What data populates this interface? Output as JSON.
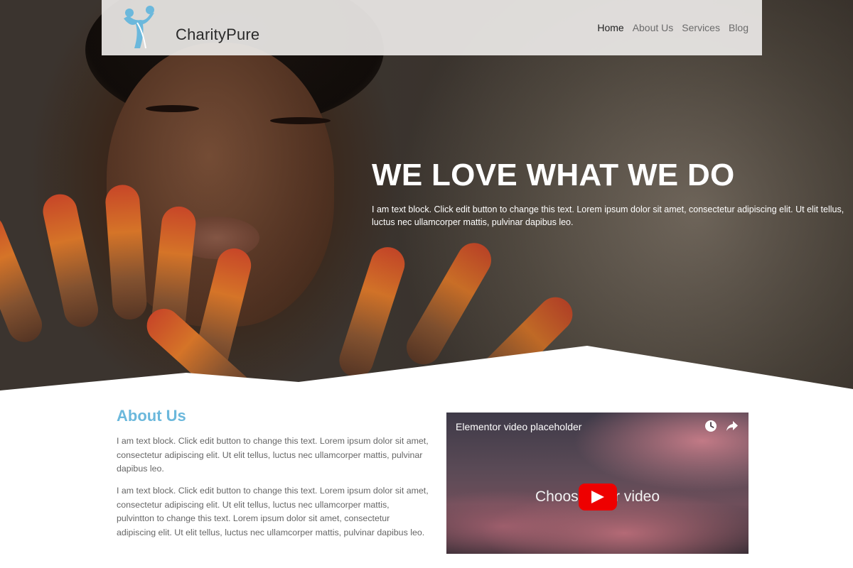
{
  "brand": {
    "name": "CharityPure",
    "logo_icon": "two-people-icon",
    "accent": "#6bb8dc"
  },
  "nav": {
    "items": [
      {
        "label": "Home",
        "active": true
      },
      {
        "label": "About Us",
        "active": false
      },
      {
        "label": "Services",
        "active": false
      },
      {
        "label": "Blog",
        "active": false
      }
    ]
  },
  "hero": {
    "title": "WE LOVE WHAT WE DO",
    "text": "I am text block. Click edit button to change this text. Lorem ipsum dolor sit amet, consectetur adipiscing elit. Ut elit tellus, luctus nec ullamcorper mattis, pulvinar dapibus leo."
  },
  "about": {
    "title": "About Us",
    "paragraph1": "I am text block. Click edit button to change this text. Lorem ipsum dolor sit amet, consectetur adipiscing elit. Ut elit tellus, luctus nec ullamcorper mattis, pulvinar dapibus leo.",
    "paragraph2": "I am text block. Click edit button to change this text. Lorem ipsum dolor sit amet, consectetur adipiscing elit. Ut elit tellus, luctus nec ullamcorper mattis, pulvintton to change this text. Lorem ipsum dolor sit amet, consectetur adipiscing elit. Ut elit tellus, luctus nec ullamcorper mattis, pulvinar dapibus leo."
  },
  "video": {
    "title": "Elementor video placeholder",
    "caption": "Choose your video",
    "watch_later_icon": "clock-icon",
    "share_icon": "share-arrow-icon",
    "play_icon": "play-icon",
    "play_color": "#ee0000"
  }
}
